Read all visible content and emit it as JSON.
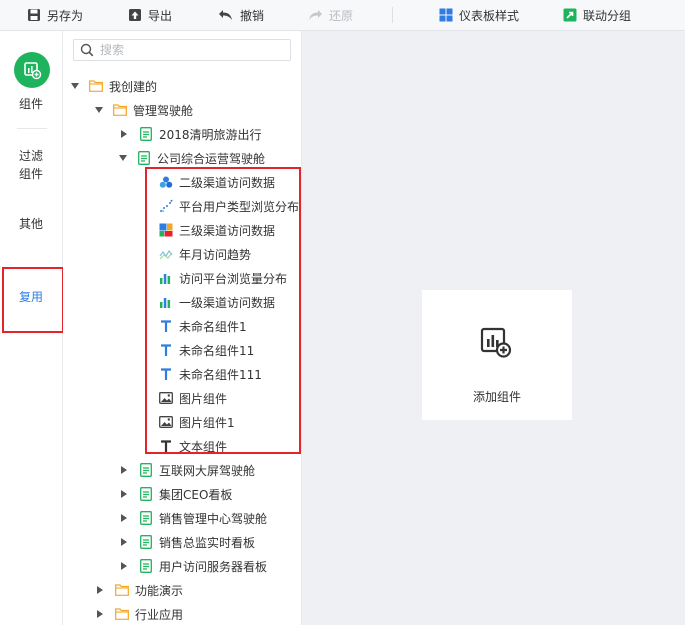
{
  "toolbar": {
    "save_as": "另存为",
    "export": "导出",
    "undo": "撤销",
    "redo": "还原",
    "dashboard_style": "仪表板样式",
    "linked_group": "联动分组"
  },
  "leftbar": {
    "components": "组件",
    "filter_line1": "过滤",
    "filter_line2": "组件",
    "other": "其他",
    "reuse": "复用"
  },
  "search": {
    "placeholder": "搜索"
  },
  "tree": {
    "root": "我创建的",
    "cockpit": "管理驾驶舱",
    "tourism": "2018清明旅游出行",
    "company": "公司综合运营驾驶舱",
    "components": [
      {
        "label": "二级渠道访问数据",
        "icon": "bubble-chart-icon"
      },
      {
        "label": "平台用户类型浏览分布",
        "icon": "scatter-chart-icon"
      },
      {
        "label": "三级渠道访问数据",
        "icon": "treemap-icon"
      },
      {
        "label": "年月访问趋势",
        "icon": "line-chart-icon"
      },
      {
        "label": "访问平台浏览量分布",
        "icon": "bar-chart-icon"
      },
      {
        "label": "一级渠道访问数据",
        "icon": "bar-chart-icon"
      },
      {
        "label": "未命名组件1",
        "icon": "text-icon"
      },
      {
        "label": "未命名组件11",
        "icon": "text-icon"
      },
      {
        "label": "未命名组件111",
        "icon": "text-icon"
      },
      {
        "label": "图片组件",
        "icon": "image-icon"
      },
      {
        "label": "图片组件1",
        "icon": "image-icon"
      },
      {
        "label": "文本组件",
        "icon": "text-icon"
      }
    ],
    "internet": "互联网大屏驾驶舱",
    "group_ceo": "集团CEO看板",
    "sales_mgmt": "销售管理中心驾驶舱",
    "sales_director": "销售总监实时看板",
    "user_access": "用户访问服务器看板",
    "demo": "功能演示",
    "industry": "行业应用"
  },
  "canvas": {
    "add_component": "添加组件"
  },
  "colors": {
    "accent": "#2e7de1",
    "green": "#1fb35d",
    "highlight": "#e4242d",
    "folder": "#f5a623"
  }
}
